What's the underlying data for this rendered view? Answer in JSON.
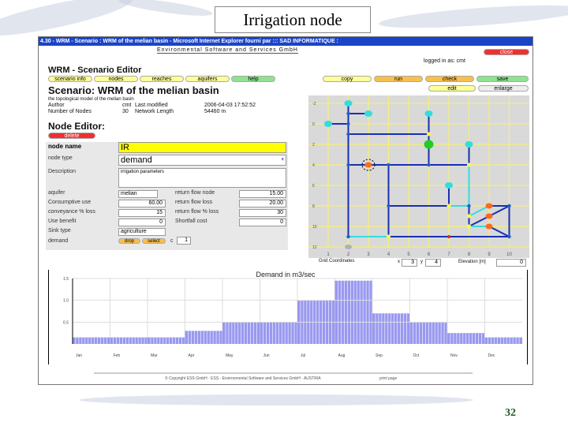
{
  "slide": {
    "title": "Irrigation node",
    "page_number": "32"
  },
  "window": {
    "title": "4.30 - WRM - Scenario : WRM of the melian basin - Microsoft Internet Explorer fourni par ::: SAD INFORMATIQUE :"
  },
  "header": {
    "company": "Environmental Software and Services GmbH",
    "close": "close",
    "logged_in": "logged in as: cmt"
  },
  "editor": {
    "title": "WRM - Scenario Editor",
    "tabs": [
      "scenario info",
      "nodes",
      "reaches",
      "aquifers",
      "help"
    ],
    "actions": [
      "copy",
      "run",
      "check",
      "save"
    ],
    "edit": "edit",
    "enlarge": "enlarge",
    "scenario_title": "Scenario: WRM of the melian basin",
    "scenario_desc": "the topological model of the melian basin",
    "author_label": "Author",
    "author": "cmt",
    "modified_label": "Last modified",
    "modified": "2006-04-03 17:52:52",
    "nodes_label": "Number of Nodes",
    "nodes": "30",
    "length_label": "Network Length",
    "length": "54460 m"
  },
  "node_editor": {
    "title": "Node Editor:",
    "delete": "delete",
    "name_label": "node name",
    "name": "IR",
    "type_label": "node type",
    "type": "demand",
    "desc_label": "Description",
    "desc": "irrigation parameters",
    "aquifer_label": "aquifer",
    "aquifer": "melian",
    "cons_label": "Consumptive use",
    "cons": "60.00",
    "conv_label": "conveyance % loss",
    "conv": "15",
    "benefit_label": "Use benefit",
    "benefit": "0",
    "sink_label": "Sink type",
    "sink": "agriculture",
    "demand_label": "demand",
    "drop": "drop",
    "select": "select",
    "c_label": "c",
    "c": "1",
    "r1_label": "return flow node",
    "r1": "15.00",
    "r2_label": "return flow loss",
    "r2": "20.00",
    "r3_label": "return flow % loss",
    "r3": "30",
    "short_label": "Shortfall cost",
    "short": "0"
  },
  "network": {
    "x_ticks": [
      "1",
      "2",
      "3",
      "4",
      "5",
      "6",
      "7",
      "8",
      "9",
      "10"
    ],
    "y_ticks": [
      "-2",
      "0",
      "2",
      "4",
      "6",
      "8",
      "10",
      "12"
    ],
    "grid_label": "Grid Coordinates",
    "x_label": "x",
    "x": "3",
    "y_label": "y",
    "y": "4",
    "elev_label": "Elevation [m]",
    "elev": "0",
    "colors": {
      "reach": "#1a2fb0",
      "return": "#33dddd",
      "node": "#1f5fc8"
    },
    "links": [
      [
        2,
        -2,
        2,
        11,
        "reach"
      ],
      [
        2,
        -1,
        3,
        -1,
        "reach"
      ],
      [
        1,
        0,
        2,
        0,
        "reach"
      ],
      [
        2,
        1,
        6,
        1,
        "reach"
      ],
      [
        6,
        -1,
        6,
        4,
        "reach"
      ],
      [
        2,
        4,
        8,
        4,
        "reach"
      ],
      [
        8,
        2,
        8,
        4,
        "reach"
      ],
      [
        8,
        4,
        8,
        8,
        "return"
      ],
      [
        4,
        4,
        4,
        11,
        "reach"
      ],
      [
        4,
        8,
        7,
        8,
        "reach"
      ],
      [
        7,
        6,
        7,
        8,
        "reach"
      ],
      [
        7,
        8,
        8,
        8,
        "return"
      ],
      [
        8,
        8,
        8,
        10,
        "reach"
      ],
      [
        8,
        9,
        9,
        8,
        "return"
      ],
      [
        9,
        8,
        10,
        8,
        "reach"
      ],
      [
        8,
        10,
        10,
        8,
        "reach"
      ],
      [
        8,
        10,
        9,
        10,
        "return"
      ],
      [
        9,
        10,
        10,
        11,
        "reach"
      ],
      [
        10,
        8,
        10,
        11,
        "reach"
      ],
      [
        2,
        11,
        4,
        11,
        "return"
      ],
      [
        4,
        11,
        10,
        11,
        "reach"
      ]
    ],
    "nodes": [
      [
        2,
        -2,
        "source"
      ],
      [
        2,
        -1,
        "junction"
      ],
      [
        3,
        -1,
        "source"
      ],
      [
        1,
        0,
        "source"
      ],
      [
        2,
        0,
        "junction"
      ],
      [
        2,
        1,
        "junction"
      ],
      [
        6,
        1,
        "confluence"
      ],
      [
        6,
        -1,
        "source"
      ],
      [
        6,
        2,
        "reservoir"
      ],
      [
        6,
        4,
        "junction"
      ],
      [
        2,
        4,
        "junction"
      ],
      [
        3,
        4,
        "demand"
      ],
      [
        4,
        4,
        "junction"
      ],
      [
        8,
        4,
        "confluence"
      ],
      [
        8,
        2,
        "source"
      ],
      [
        7,
        6,
        "source"
      ],
      [
        7,
        8,
        "confluence"
      ],
      [
        4,
        8,
        "junction"
      ],
      [
        8,
        8,
        "junction"
      ],
      [
        8,
        9,
        "confluence"
      ],
      [
        8,
        10,
        "confluence"
      ],
      [
        9,
        8,
        "demand"
      ],
      [
        9,
        9,
        "demand"
      ],
      [
        9,
        10,
        "demand"
      ],
      [
        10,
        8,
        "junction"
      ],
      [
        10,
        11,
        "junction"
      ],
      [
        2,
        11,
        "junction"
      ],
      [
        4,
        11,
        "confluence"
      ],
      [
        7,
        11,
        "gauge"
      ],
      [
        2,
        12,
        "sink"
      ]
    ],
    "selected": [
      3,
      4
    ]
  },
  "chart_data": {
    "type": "bar",
    "title": "Demand in m3/sec",
    "categories": [
      "Jan",
      "Feb",
      "Mar",
      "Apr",
      "May",
      "Jun",
      "Jul",
      "Aug",
      "Sep",
      "Oct",
      "Nov",
      "Dec"
    ],
    "values": [
      0.15,
      0.15,
      0.15,
      0.3,
      0.5,
      0.5,
      1.0,
      1.45,
      0.7,
      0.5,
      0.25,
      0.15
    ],
    "y_ticks": [
      "0.5",
      "1.0",
      "1.5"
    ],
    "ylim": [
      0,
      1.5
    ],
    "grid": true,
    "color": "#9999f0"
  },
  "footer": {
    "text": "© Copyright ESS GmbH · ESS · Environmental Software and Services GmbH · AUSTRIA",
    "print": "print page"
  }
}
